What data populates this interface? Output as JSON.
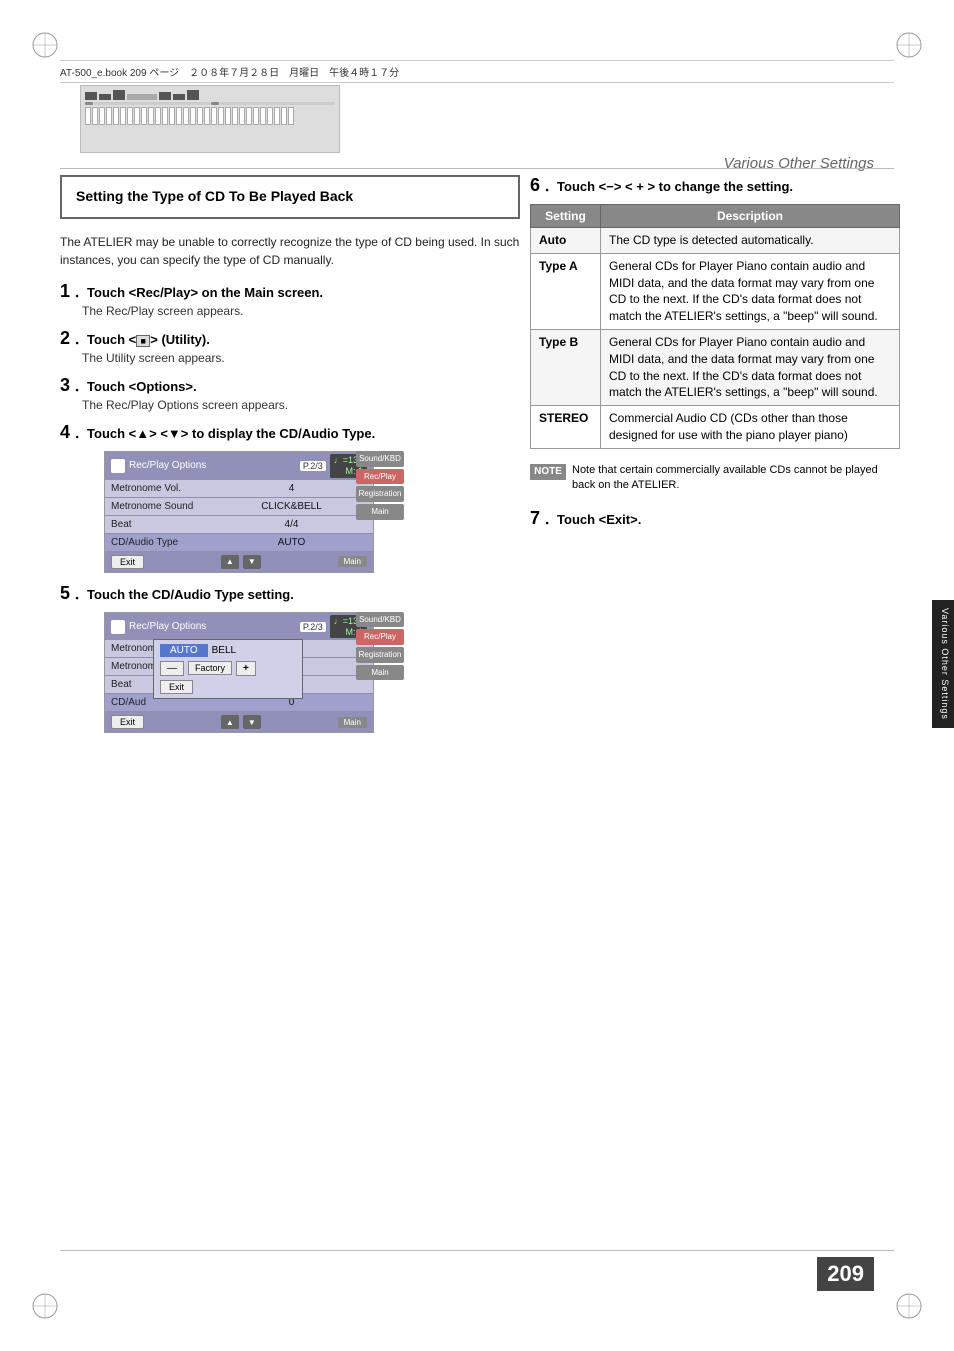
{
  "page": {
    "number": "209",
    "section_title": "Various Other Settings",
    "file_info": "AT-500_e.book  209 ページ　２０８年７月２８日　月曜日　午後４時１７分"
  },
  "section": {
    "title": "Setting the Type of CD To Be Played Back",
    "intro": "The ATELIER may be unable to correctly recognize the type of CD being used. In such instances, you can specify the type of CD manually."
  },
  "steps": [
    {
      "num": "1",
      "instruction": "Touch <Rec/Play> on the Main screen.",
      "sub": "The Rec/Play screen appears."
    },
    {
      "num": "2",
      "instruction": "Touch < ■ > (Utility).",
      "sub": "The Utility screen appears."
    },
    {
      "num": "3",
      "instruction": "Touch <Options>.",
      "sub": "The Rec/Play Options screen appears."
    },
    {
      "num": "4",
      "instruction": "Touch < ▲ > < ▼ > to display the CD/Audio Type.",
      "sub": ""
    },
    {
      "num": "5",
      "instruction": "Touch the CD/Audio Type setting.",
      "sub": ""
    }
  ],
  "step6": {
    "num": "6",
    "instruction": "Touch < − > < + > to change the setting."
  },
  "step7": {
    "num": "7",
    "instruction": "Touch <Exit>."
  },
  "screen4": {
    "title": "Rec/Play Options",
    "page": "P.2/3",
    "tempo": "♩=130",
    "measure": "M: 1",
    "rows": [
      {
        "label": "Metronome Vol.",
        "value": "4"
      },
      {
        "label": "Metronome Sound",
        "value": "CLICK&BELL"
      },
      {
        "label": "Beat",
        "value": "4/4"
      },
      {
        "label": "CD/Audio Type",
        "value": "AUTO"
      }
    ],
    "sidebar_buttons": [
      "Sound/KBD",
      "Rec/Play",
      "Registration",
      "Main"
    ],
    "exit_btn": "Exit"
  },
  "screen5": {
    "title": "Rec/Play Options",
    "page": "P.2/3",
    "tempo": "♩=130",
    "measure": "M: 1",
    "rows": [
      {
        "label": "Metronome Vol.",
        "value": "4"
      },
      {
        "label": "Metronome Sound",
        "value": ""
      },
      {
        "label": "Beat",
        "value": ""
      },
      {
        "label": "CD/Audio Type",
        "value": "0"
      }
    ],
    "overlay": {
      "highlight": "AUTO",
      "bell_text": "BELL",
      "minus": "—",
      "factory": "Factory",
      "plus": "+",
      "exit": "Exit"
    },
    "sidebar_buttons": [
      "Sound/KBD",
      "Rec/Play",
      "Registration",
      "Main"
    ],
    "exit_btn": "Exit"
  },
  "settings_table": {
    "col1": "Setting",
    "col2": "Description",
    "rows": [
      {
        "setting": "Auto",
        "description": "The CD type is detected automatically."
      },
      {
        "setting": "Type A",
        "description": "General CDs for Player Piano contain audio and MIDI data, and the data format may vary from one CD to the next. If the CD's data format does not match the ATELIER's settings, a \"beep\" will sound."
      },
      {
        "setting": "Type B",
        "description": "format does not match the ATELIER's settings, a \"beep\" will sound."
      },
      {
        "setting": "STEREO",
        "description": "Commercial Audio CD (CDs other than those designed for use with the piano player piano)"
      }
    ]
  },
  "note": {
    "label": "NOTE",
    "text": "Note that certain commercially available CDs cannot be played back on the ATELIER."
  }
}
